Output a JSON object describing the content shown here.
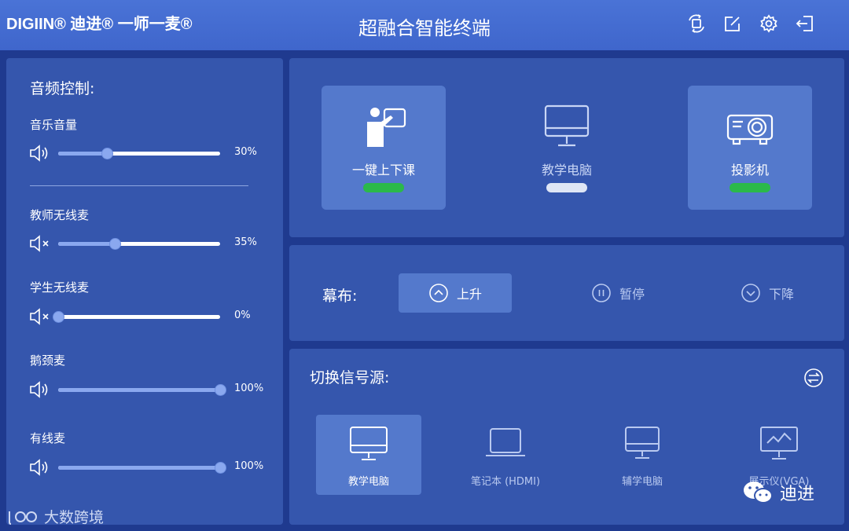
{
  "header": {
    "brand": "DIGIIN® 迪进® 一师一麦®",
    "title": "超融合智能终端",
    "icons": [
      "sync-icon",
      "edit-icon",
      "gear-icon",
      "logout-icon"
    ]
  },
  "audio": {
    "title": "音频控制:",
    "channels": [
      {
        "label": "音乐音量",
        "value": 30,
        "display": "30%",
        "muted": false
      },
      {
        "label": "教师无线麦",
        "value": 35,
        "display": "35%",
        "muted": true
      },
      {
        "label": "学生无线麦",
        "value": 0,
        "display": "0%",
        "muted": true
      },
      {
        "label": "鹅颈麦",
        "value": 100,
        "display": "100%",
        "muted": false
      },
      {
        "label": "有线麦",
        "value": 100,
        "display": "100%",
        "muted": false
      }
    ]
  },
  "devices": {
    "cards": [
      {
        "label": "一键上下课",
        "status": "on",
        "active": true
      },
      {
        "label": "教学电脑",
        "status": "off",
        "active": false
      },
      {
        "label": "投影机",
        "status": "on",
        "active": true
      }
    ],
    "colors": {
      "on": "#2bb94a",
      "off": "#dfe6f5"
    }
  },
  "curtain": {
    "label": "幕布:",
    "buttons": [
      {
        "label": "上升",
        "active": true
      },
      {
        "label": "暂停",
        "active": false
      },
      {
        "label": "下降",
        "active": false
      }
    ]
  },
  "signal": {
    "title": "切换信号源:",
    "sources": [
      {
        "label": "教学电脑",
        "active": true
      },
      {
        "label": "笔记本 (HDMI)",
        "active": false
      },
      {
        "label": "辅学电脑",
        "active": false
      },
      {
        "label": "展示仪(VGA)",
        "active": false
      }
    ]
  },
  "watermark": {
    "left_text": "大数跨境",
    "right_text": "迪进"
  }
}
